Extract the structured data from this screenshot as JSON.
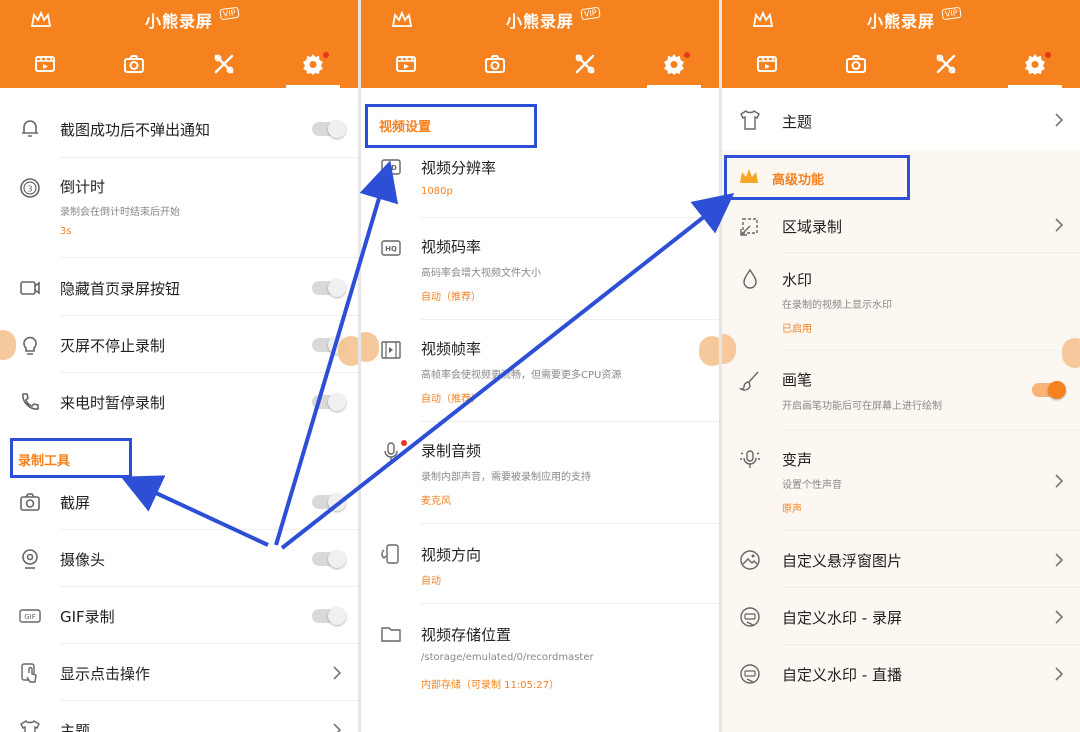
{
  "app": {
    "title": "小熊录屏",
    "vip_badge": "VIP"
  },
  "colors": {
    "accent": "#f5821f",
    "annotation": "#2d4fd6",
    "header_text": "#ffffff"
  },
  "tabs": [
    "video-icon",
    "camera-icon",
    "tools-icon",
    "gear-icon"
  ],
  "panel1": {
    "rows": [
      {
        "title": "截图成功后不弹出通知",
        "icon": "bell-icon",
        "control": "toggle-off"
      },
      {
        "title": "倒计时",
        "subtitle": "录制会在倒计时结束后开始",
        "value": "3s",
        "icon": "timer-icon"
      },
      {
        "title": "隐藏首页录屏按钮",
        "icon": "record-button-icon",
        "control": "toggle-off"
      },
      {
        "title": "灭屏不停止录制",
        "icon": "bulb-icon",
        "control": "toggle-off"
      },
      {
        "title": "来电时暂停录制",
        "icon": "phone-icon",
        "control": "toggle-off"
      }
    ],
    "section": "录制工具",
    "tools": [
      {
        "title": "截屏",
        "icon": "camera-icon",
        "control": "toggle-off"
      },
      {
        "title": "摄像头",
        "icon": "webcam-icon",
        "control": "toggle-off"
      },
      {
        "title": "GIF录制",
        "icon": "gif-icon",
        "control": "toggle-off"
      },
      {
        "title": "显示点击操作",
        "icon": "touch-icon",
        "control": "chevron"
      },
      {
        "title": "主题",
        "icon": "shirt-icon",
        "control": "chevron"
      }
    ]
  },
  "panel2": {
    "section": "视频设置",
    "rows": [
      {
        "title": "视频分辨率",
        "value": "1080p",
        "icon": "hd-icon"
      },
      {
        "title": "视频码率",
        "subtitle": "高码率会增大视频文件大小",
        "value": "自动（推荐）",
        "icon": "hq-icon"
      },
      {
        "title": "视频帧率",
        "subtitle": "高帧率会使视频更流畅，但需要更多CPU资源",
        "value": "自动（推荐）",
        "icon": "film-icon"
      },
      {
        "title": "录制音频",
        "subtitle": "录制内部声音，需要被录制应用的支持",
        "value": "麦克风",
        "icon": "mic-icon"
      },
      {
        "title": "视频方向",
        "value": "自动",
        "icon": "rotate-icon"
      },
      {
        "title": "视频存储位置",
        "subtitle": "/storage/emulated/0/recordmaster",
        "value": "内部存储（可录制 11:05:27）",
        "icon": "folder-icon"
      }
    ]
  },
  "panel3": {
    "theme": {
      "title": "主题",
      "icon": "shirt-icon"
    },
    "section": "高级功能",
    "rows": [
      {
        "title": "区域录制",
        "icon": "crop-icon",
        "control": "chevron"
      },
      {
        "title": "水印",
        "subtitle": "在录制的视频上显示水印",
        "value": "已启用",
        "icon": "drop-icon"
      },
      {
        "title": "画笔",
        "subtitle": "开启画笔功能后可在屏幕上进行绘制",
        "icon": "brush-icon",
        "control": "toggle-on"
      },
      {
        "title": "变声",
        "subtitle": "设置个性声音",
        "value": "原声",
        "icon": "voice-icon",
        "control": "chevron"
      },
      {
        "title": "自定义悬浮窗图片",
        "icon": "image-icon",
        "control": "chevron"
      },
      {
        "title": "自定义水印 - 录屏",
        "icon": "watermark-icon",
        "control": "chevron"
      },
      {
        "title": "自定义水印 - 直播",
        "icon": "watermark-live-icon",
        "control": "chevron"
      }
    ]
  }
}
